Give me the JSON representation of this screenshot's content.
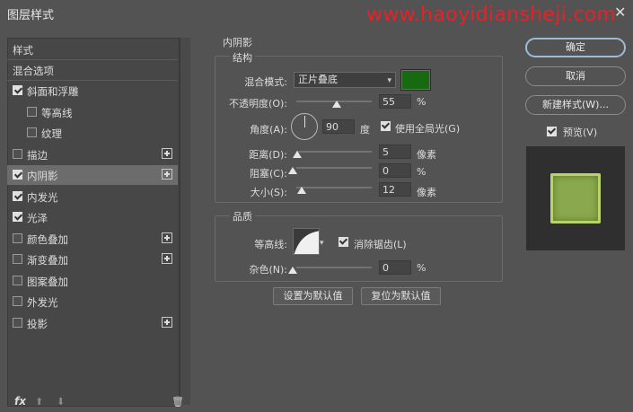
{
  "window": {
    "title": "图层样式",
    "watermark": "www.haoyidiansheji.com",
    "close_glyph": "✕"
  },
  "left": {
    "header": "样式",
    "blend_options": "混合选项",
    "items": [
      {
        "label": "斜面和浮雕",
        "checked": true,
        "plus": false
      },
      {
        "label": "等高线",
        "checked": false,
        "plus": false,
        "sub": true
      },
      {
        "label": "纹理",
        "checked": false,
        "plus": false,
        "sub": true
      },
      {
        "label": "描边",
        "checked": false,
        "plus": true
      },
      {
        "label": "内阴影",
        "checked": true,
        "plus": true,
        "selected": true
      },
      {
        "label": "内发光",
        "checked": true,
        "plus": false
      },
      {
        "label": "光泽",
        "checked": true,
        "plus": false
      },
      {
        "label": "颜色叠加",
        "checked": false,
        "plus": true
      },
      {
        "label": "渐变叠加",
        "checked": false,
        "plus": true
      },
      {
        "label": "图案叠加",
        "checked": false,
        "plus": false
      },
      {
        "label": "外发光",
        "checked": false,
        "plus": false
      },
      {
        "label": "投影",
        "checked": false,
        "plus": true
      }
    ],
    "footer": {
      "fx": "fx",
      "up": "⬆",
      "down": "⬇",
      "trash": "🗑"
    }
  },
  "main": {
    "section_title": "内阴影",
    "structure": {
      "title": "结构",
      "blend_mode_label": "混合模式:",
      "blend_mode_value": "正片叠底",
      "shadow_color": "#176a10",
      "opacity_label": "不透明度(O):",
      "opacity_value": "55",
      "opacity_unit": "%",
      "angle_label": "角度(A):",
      "angle_value": "90",
      "angle_unit": "度",
      "global_light_label": "使用全局光(G)",
      "global_light_checked": true,
      "distance_label": "距离(D):",
      "distance_value": "5",
      "distance_unit": "像素",
      "choke_label": "阻塞(C):",
      "choke_value": "0",
      "choke_unit": "%",
      "size_label": "大小(S):",
      "size_value": "12",
      "size_unit": "像素"
    },
    "quality": {
      "title": "品质",
      "contour_label": "等高线:",
      "anti_alias_label": "消除锯齿(L)",
      "anti_alias_checked": true,
      "noise_label": "杂色(N):",
      "noise_value": "0",
      "noise_unit": "%"
    },
    "buttons": {
      "set_default": "设置为默认值",
      "reset_default": "复位为默认值"
    }
  },
  "right": {
    "ok": "确定",
    "cancel": "取消",
    "new_style": "新建样式(W)...",
    "preview_label": "预览(V)",
    "preview_checked": true,
    "preview_color": "#8aa84d"
  }
}
